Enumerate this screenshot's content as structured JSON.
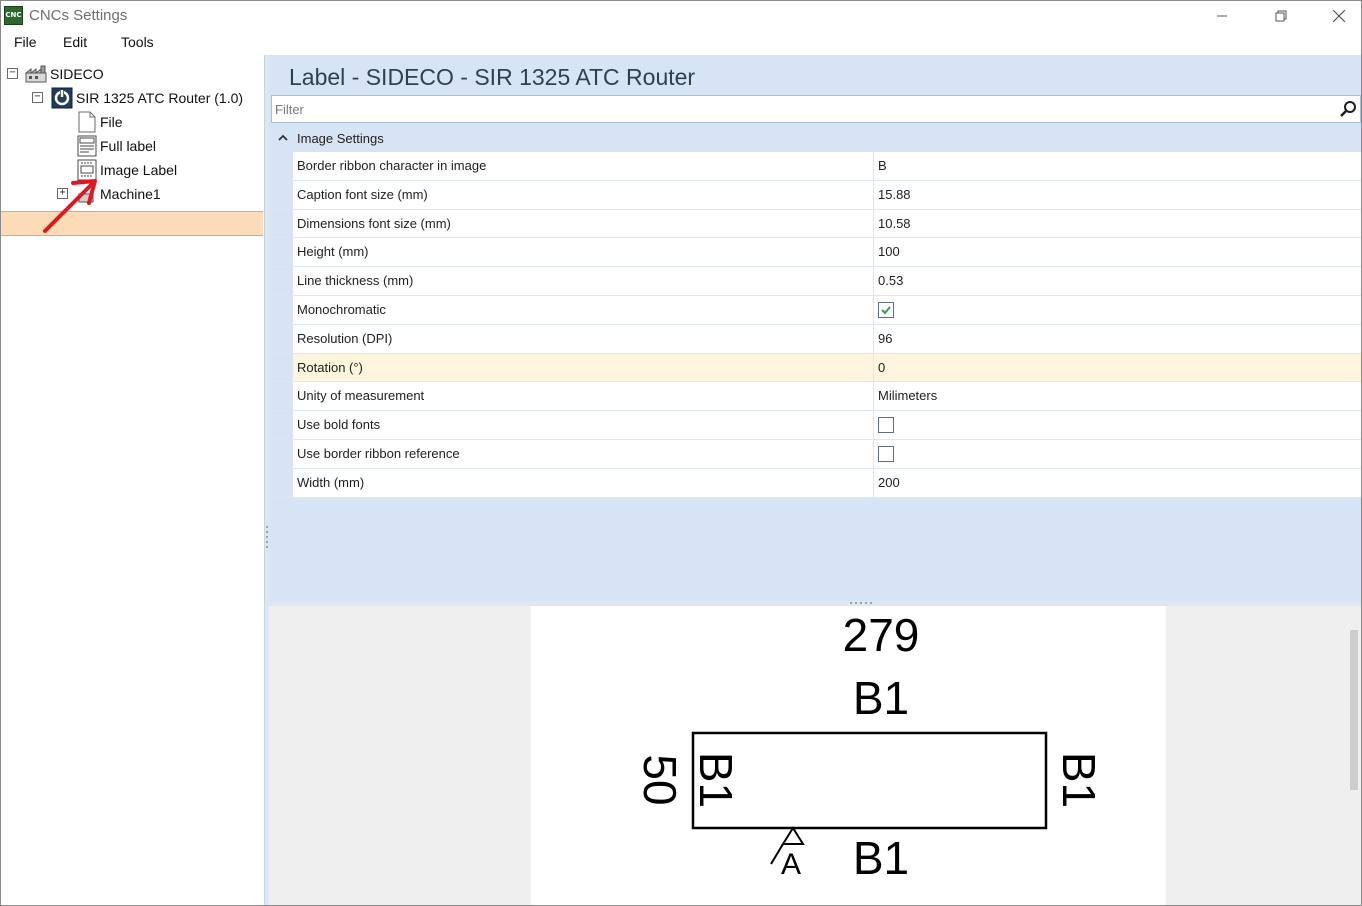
{
  "window": {
    "title": "CNCs Settings",
    "app_icon_text": "CNC"
  },
  "menu": {
    "file": "File",
    "edit": "Edit",
    "tools": "Tools"
  },
  "tree": {
    "root": "SIDECO",
    "machine": "SIR 1325 ATC Router (1.0)",
    "items": [
      "File",
      "Full label",
      "Image Label",
      "Machine1"
    ],
    "selected": "Image Label"
  },
  "content": {
    "title": "Label - SIDECO - SIR 1325 ATC Router",
    "filter_placeholder": "Filter",
    "category": "Image Settings",
    "properties": [
      {
        "name": "Border ribbon character in image",
        "value": "B"
      },
      {
        "name": "Caption font size (mm)",
        "value": "15.88"
      },
      {
        "name": "Dimensions font size (mm)",
        "value": "10.58"
      },
      {
        "name": "Height (mm)",
        "value": "100"
      },
      {
        "name": "Line thickness (mm)",
        "value": "0.53"
      },
      {
        "name": "Monochromatic",
        "checked": true
      },
      {
        "name": "Resolution (DPI)",
        "value": "96"
      },
      {
        "name": "Rotation (°)",
        "value": "0"
      },
      {
        "name": "Unity of measurement",
        "value": "Milimeters"
      },
      {
        "name": "Use bold fonts",
        "checked": false
      },
      {
        "name": "Use border ribbon reference",
        "checked": false
      },
      {
        "name": "Width (mm)",
        "value": "200"
      }
    ]
  },
  "preview": {
    "length": "279",
    "width": "50",
    "top_edge": "B1",
    "bottom_edge": "B1",
    "left_edge": "B1",
    "right_edge": "B1",
    "reference": "A"
  },
  "colors": {
    "accent_panel": "#d6e4f6",
    "selection": "#fcdcb6",
    "highlight_row": "#fdf5dd",
    "annotation_arrow": "#e8141c",
    "check_green": "#2e9e4f"
  }
}
